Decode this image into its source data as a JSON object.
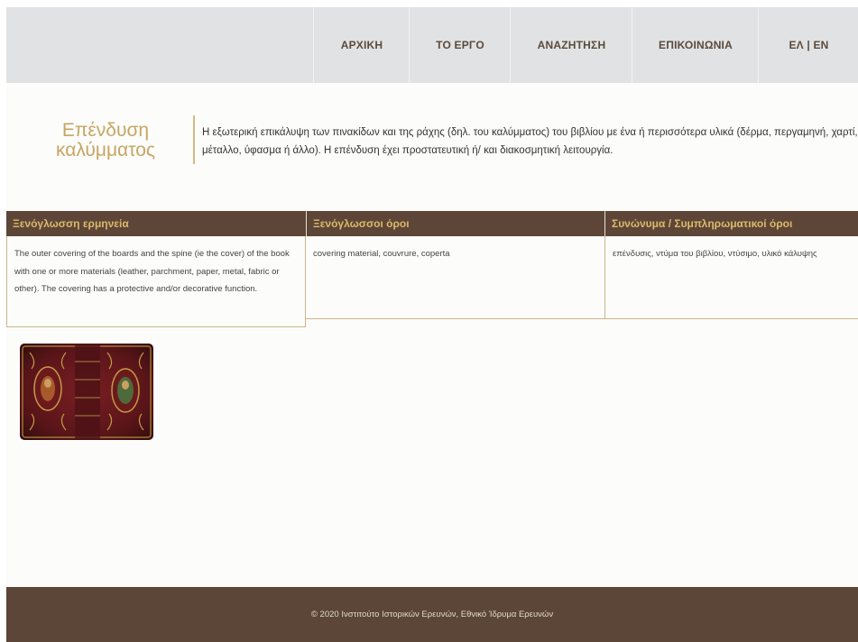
{
  "nav": {
    "items": [
      {
        "label": "ΑΡΧΙΚΗ"
      },
      {
        "label": "ΤΟ ΕΡΓΟ"
      },
      {
        "label": "ΑΝΑΖΗΤΗΣΗ"
      },
      {
        "label": "ΕΠΙΚΟΙΝΩΝΙΑ"
      },
      {
        "label": "ΕΛ | ΕΝ"
      }
    ]
  },
  "term": {
    "title": "Επένδυση καλύμματος",
    "definition": "Η εξωτερική επικάλυψη των πινακίδων και της ράχης (δηλ. του καλύμματος) του βιβλίου με ένα ή περισσότερα υλικά (δέρμα, περγαμηνή, χαρτί, μέταλλο, ύφασμα ή άλλο). Η επένδυση έχει προστατευτική ή/ και διακοσμητική λειτουργία."
  },
  "table": {
    "foreign_interpretation": {
      "header": "Ξενόγλωσση ερμηνεία",
      "text": "The outer covering of the boards and the spine (ie the cover) of the book with one or more materials (leather, parchment, paper, metal, fabric or other). The covering has a protective and/or decorative function."
    },
    "foreign_terms": {
      "header": "Ξενόγλωσσοι όροι",
      "text": "covering material, couvrure, coperta"
    },
    "synonyms": {
      "header": "Συνώνυμα / Συμπληρωματικοί όροι",
      "text": "επένδυσις, ντύμα του βιβλίου, ντύσιμο, υλικό κάλυψης"
    }
  },
  "colors": {
    "accent": "#c6a662",
    "header_bg": "#5d4637",
    "header_text": "#dcb96c",
    "nav_bg": "#e1e2e3",
    "footer_bg": "#5b4637"
  },
  "footer": {
    "text": "© 2020 Ινστιτούτο Ιστορικών Ερευνών, Εθνικό Ίδρυμα Ερευνών"
  }
}
